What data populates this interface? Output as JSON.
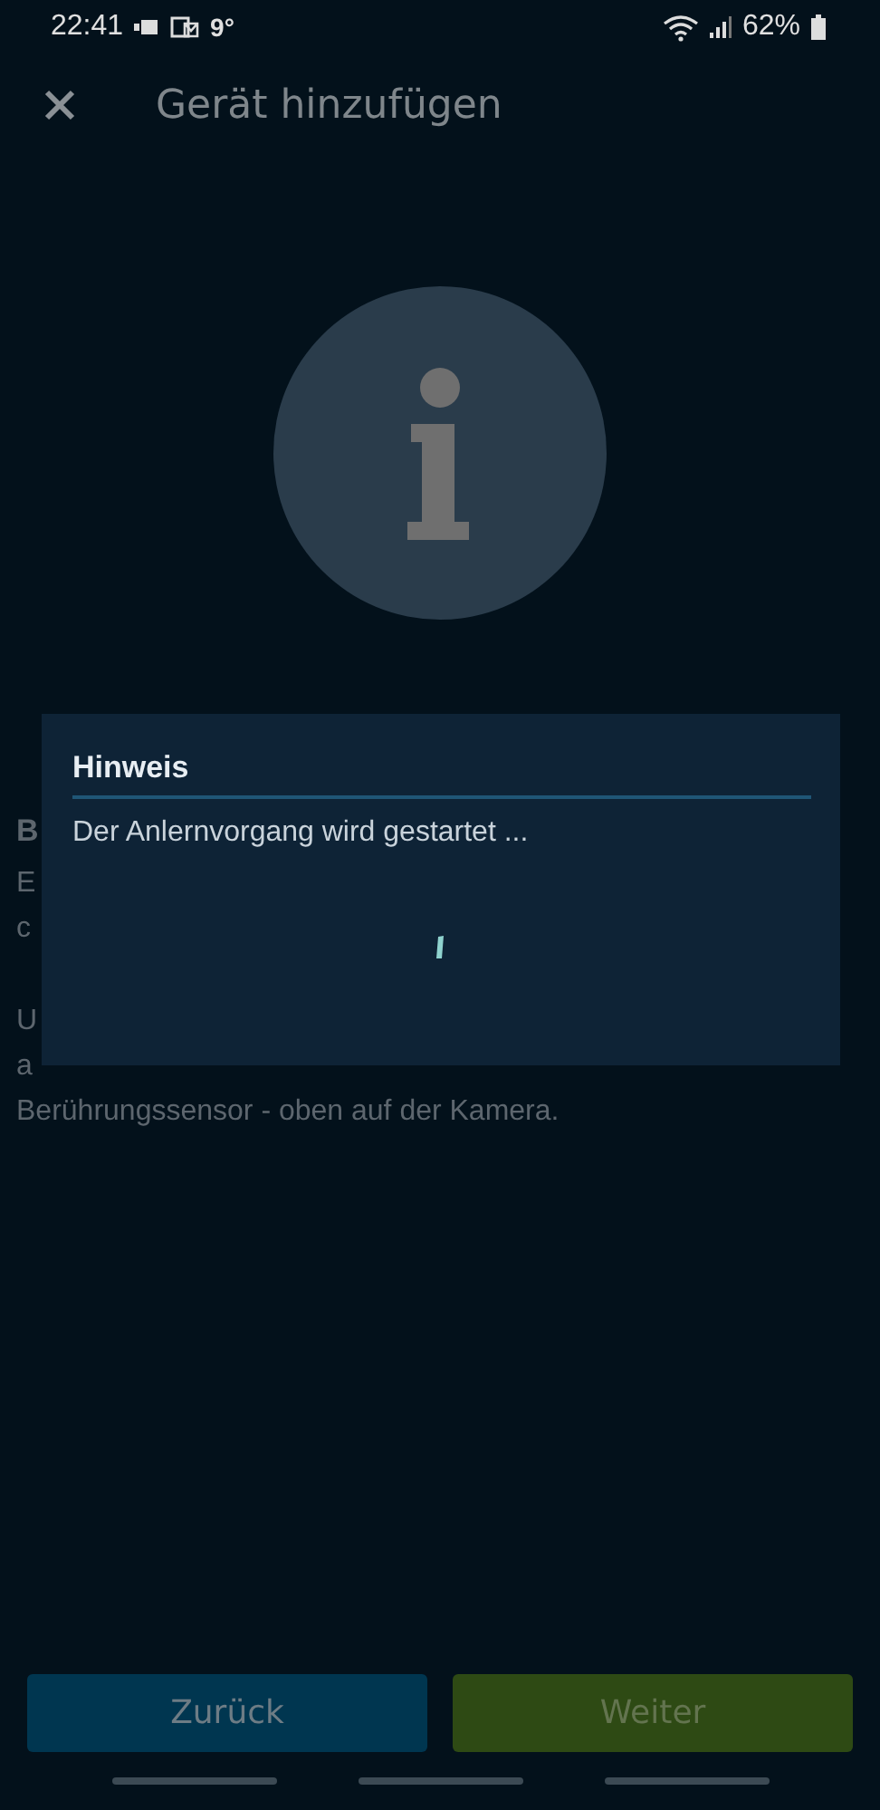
{
  "status_bar": {
    "time": "22:41",
    "temperature": "9°",
    "battery": "62%"
  },
  "header": {
    "title": "Gerät hinzufügen"
  },
  "background_text": [
    {
      "kind": "heading",
      "text": "B"
    },
    {
      "kind": "line",
      "text": "E"
    },
    {
      "kind": "line",
      "text": "c"
    },
    {
      "kind": "gap"
    },
    {
      "kind": "line",
      "text": "U"
    },
    {
      "kind": "line",
      "text": "a"
    },
    {
      "kind": "line",
      "text": "Berührungssensor - oben auf der Kamera."
    }
  ],
  "dialog": {
    "title": "Hinweis",
    "message": "Der Anlernvorgang wird gestartet ..."
  },
  "buttons": [
    {
      "label": "Zurück",
      "kind": "secondary"
    },
    {
      "label": "Weiter",
      "kind": "primary"
    }
  ]
}
